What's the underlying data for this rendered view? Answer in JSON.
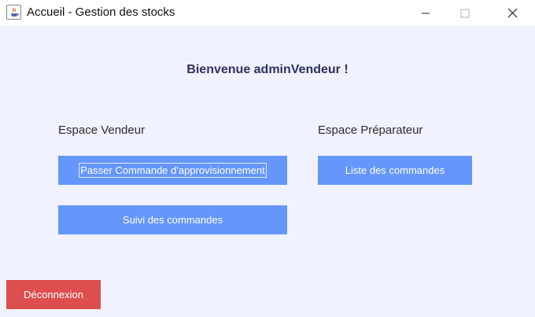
{
  "window": {
    "title": "Accueil - Gestion des stocks",
    "icon": "java-icon"
  },
  "main": {
    "welcome": "Bienvenue adminVendeur !",
    "seller": {
      "title": "Espace Vendeur",
      "order_button": "Passer Commande d'approvisionnement",
      "track_button": "Suivi des commandes"
    },
    "preparer": {
      "title": "Espace Préparateur",
      "list_button": "Liste des commandes"
    },
    "logout_button": "Déconnexion"
  },
  "colors": {
    "background": "#f0f3ff",
    "primary_button": "#6596fc",
    "danger_button": "#de4e4f",
    "welcome_text": "#2d3060"
  }
}
